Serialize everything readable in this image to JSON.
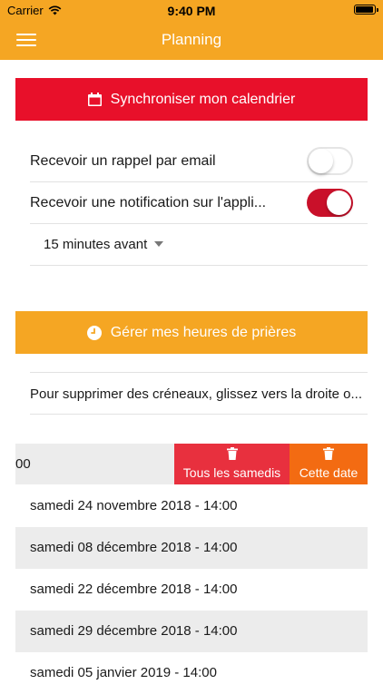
{
  "status_bar": {
    "carrier": "Carrier",
    "time": "9:40 PM",
    "battery_level": 0.95
  },
  "nav": {
    "title": "Planning",
    "menu_icon": "hamburger-icon"
  },
  "sync_button": {
    "label": "Synchroniser mon calendrier",
    "icon": "calendar-icon",
    "color": "#e8102a"
  },
  "settings": {
    "email_reminder": {
      "label": "Recevoir un rappel par email",
      "enabled": false
    },
    "app_notification": {
      "label": "Recevoir une notification sur l'appli...",
      "enabled": true
    },
    "delay": {
      "value": "15 minutes avant"
    }
  },
  "prayer_button": {
    "label": "Gérer mes heures de prières",
    "icon": "clock-icon",
    "color": "#f5a623"
  },
  "info": {
    "text": "Pour supprimer des créneaux, glissez vers la droite o..."
  },
  "swipe_row": {
    "partial_text": "00",
    "actions": [
      {
        "label": "Tous les samedis",
        "icon": "trash-icon",
        "color": "#e8303e"
      },
      {
        "label": "Cette date",
        "icon": "trash-icon",
        "color": "#f36b12"
      }
    ]
  },
  "slots": [
    {
      "text": "samedi 24 novembre 2018 - 14:00"
    },
    {
      "text": "samedi 08 décembre 2018 - 14:00"
    },
    {
      "text": "samedi 22 décembre 2018 - 14:00"
    },
    {
      "text": "samedi 29 décembre 2018 - 14:00"
    },
    {
      "text": "samedi 05 janvier 2019 - 14:00"
    }
  ]
}
